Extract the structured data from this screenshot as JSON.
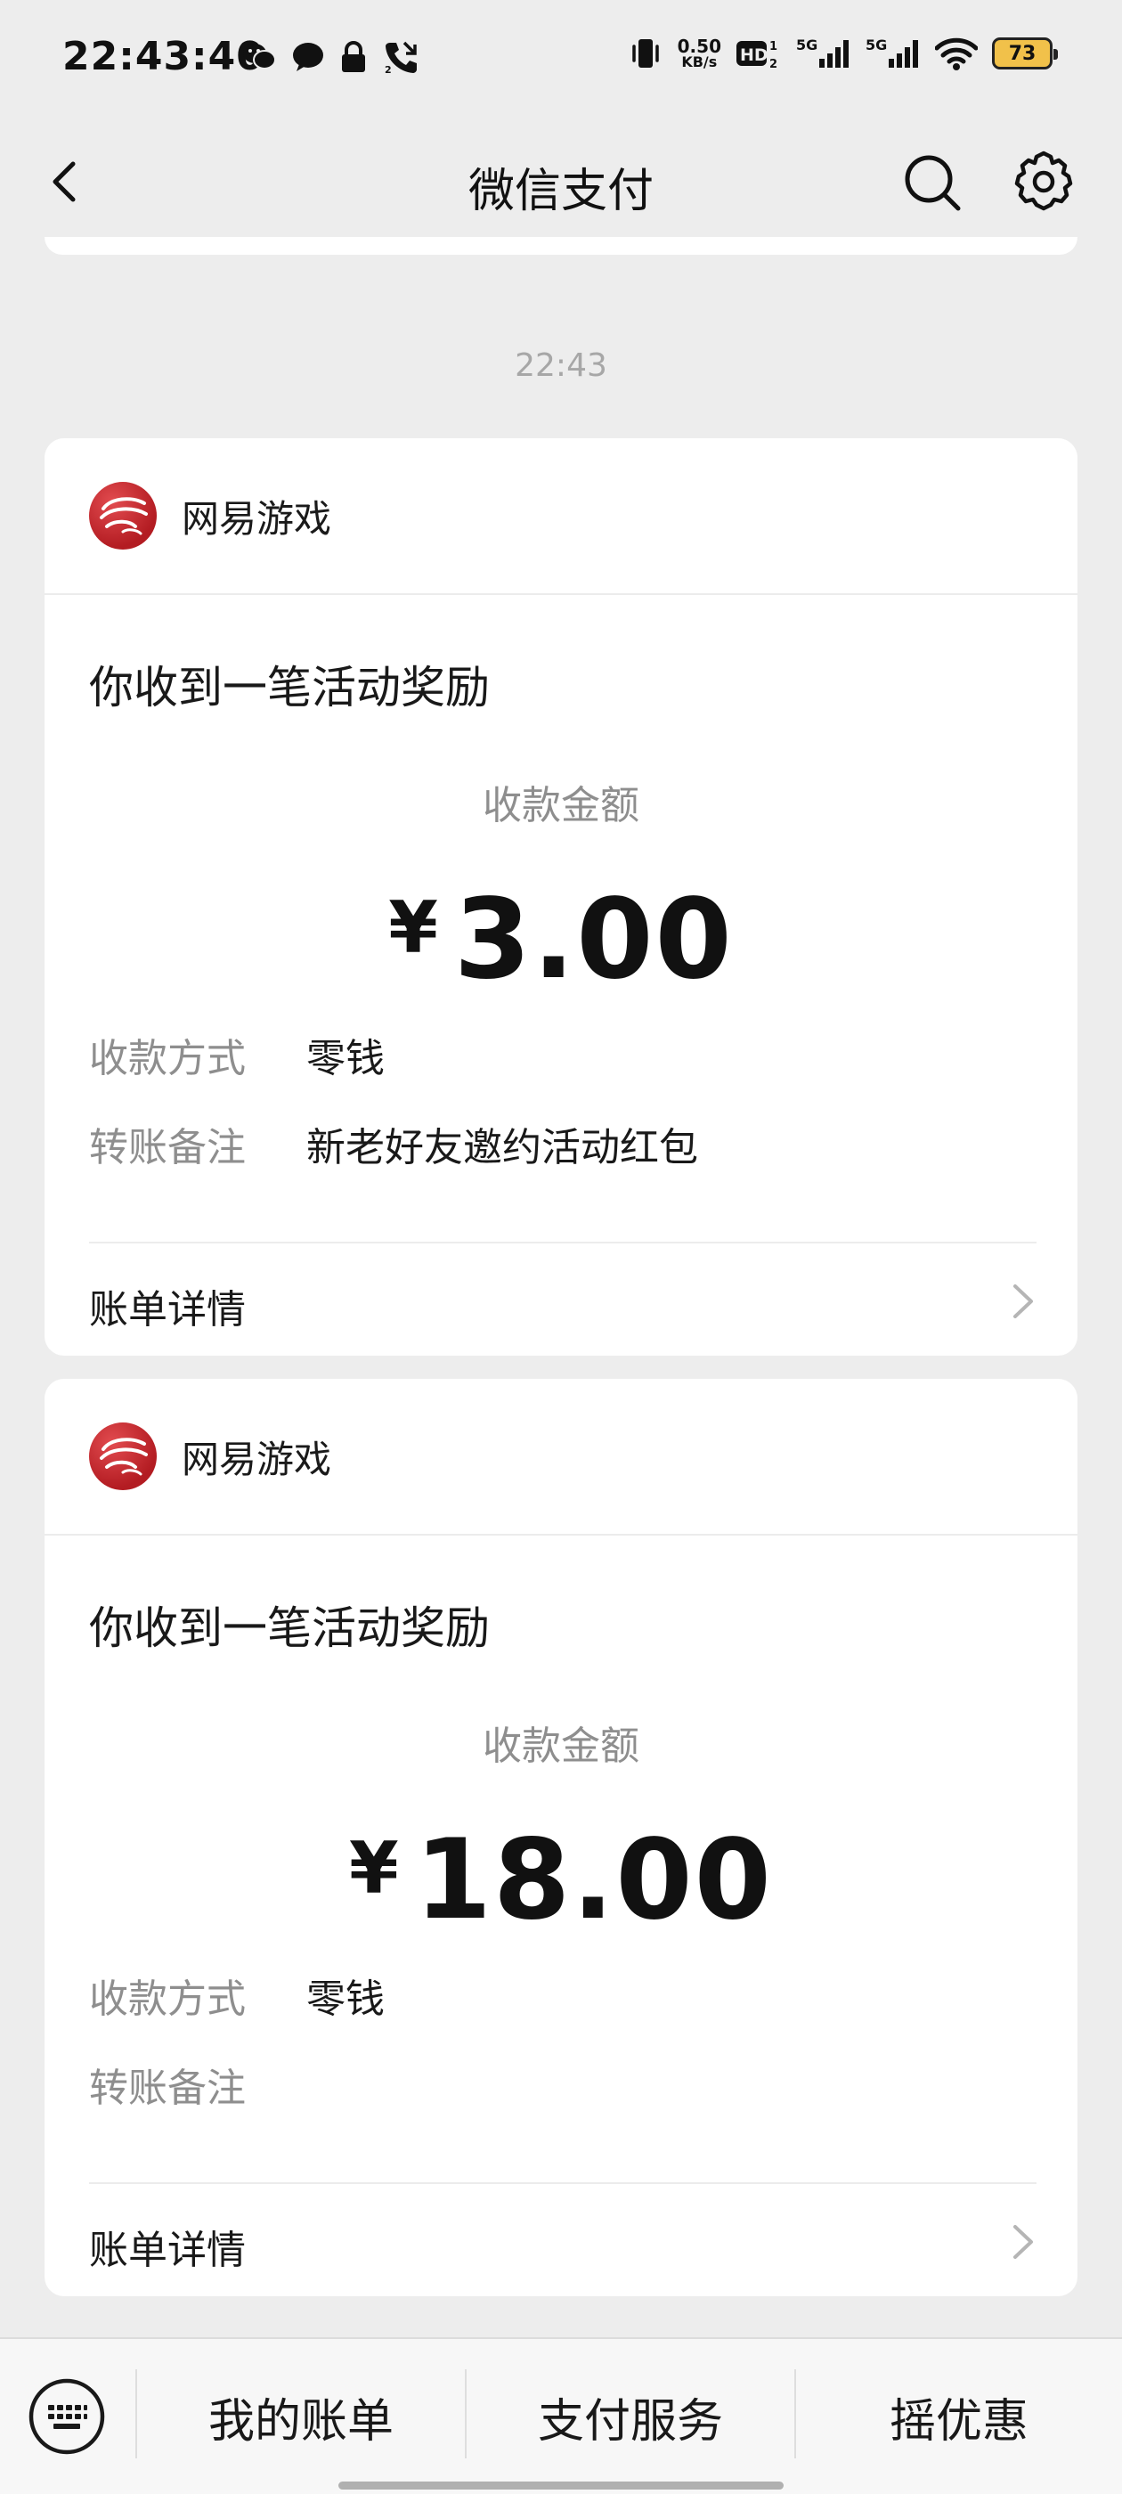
{
  "status_bar": {
    "time": "22:43:40",
    "net_speed_value": "0.50",
    "net_speed_unit": "KB/s",
    "battery": "73",
    "left_icons": [
      "wechat-icon",
      "chat-bubble-icon",
      "lock-icon",
      "phone-call-icon"
    ],
    "right_icons": [
      "vibrate-icon",
      "hd-icon",
      "signal-5g-icon",
      "signal-5g-icon",
      "wifi-icon"
    ],
    "network_label": "5G"
  },
  "nav": {
    "title": "微信支付",
    "back_icon": "back-arrow-icon",
    "search_icon": "search-icon",
    "settings_icon": "gear-icon"
  },
  "timestamp": "22:43",
  "cards": [
    {
      "brand": "网易游戏",
      "title": "你收到一笔活动奖励",
      "amount_label": "收款金额",
      "currency": "¥",
      "amount": "3.00",
      "method_key": "收款方式",
      "method_value": "零钱",
      "note_key": "转账备注",
      "note_value": "新老好友邀约活动红包",
      "footer": "账单详情"
    },
    {
      "brand": "网易游戏",
      "title": "你收到一笔活动奖励",
      "amount_label": "收款金额",
      "currency": "¥",
      "amount": "18.00",
      "method_key": "收款方式",
      "method_value": "零钱",
      "note_key": "转账备注",
      "note_value": "",
      "footer": "账单详情"
    }
  ],
  "bottom_menu": {
    "keyboard_icon": "keyboard-icon",
    "items": [
      "我的账单",
      "支付服务",
      "摇优惠"
    ]
  },
  "colors": {
    "background": "#ededed",
    "card": "#ffffff",
    "muted_text": "#8e8e8e",
    "brand_red": "#c8232a",
    "battery_fill": "#f1c14a"
  }
}
